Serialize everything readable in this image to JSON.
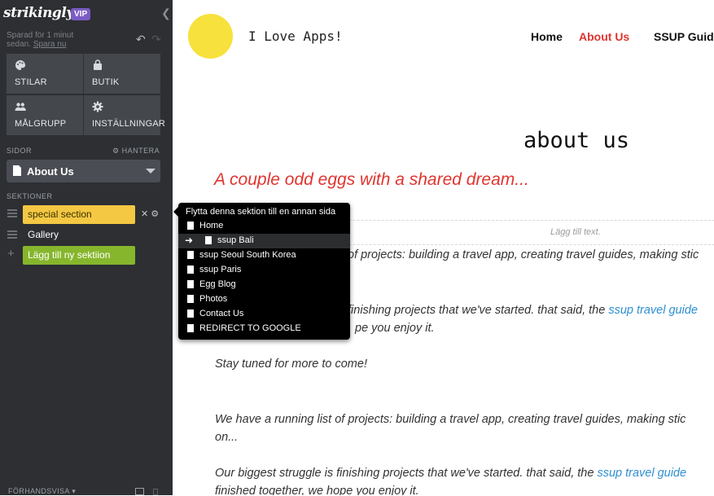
{
  "sidebar": {
    "logo": "strikingly",
    "vip_badge": "VIP",
    "saved_text": "Sparad för 1 minut sedan.",
    "save_now": "Spara nu",
    "tiles": [
      {
        "label": "STILAR",
        "icon": "palette-icon"
      },
      {
        "label": "BUTIK",
        "icon": "shopping-bag-icon"
      },
      {
        "label": "MÅLGRUPP",
        "icon": "people-icon"
      },
      {
        "label": "INSTÄLLNINGAR",
        "icon": "gear-icon"
      }
    ],
    "pages_label": "SIDOR",
    "manage_label": "HANTERA",
    "current_page": "About Us",
    "sections_label": "SEKTIONER",
    "sections": [
      "special section",
      "Gallery"
    ],
    "add_section": "Lägg till ny sektiion",
    "preview_label": "FÖRHANDSVISA"
  },
  "popup": {
    "title": "Flytta denna sektion till en annan sida",
    "items": [
      "Home",
      "ssup Bali",
      "ssup Seoul South Korea",
      "ssup Paris",
      "Egg Blog",
      "Photos",
      "Contact Us",
      "REDIRECT TO GOOGLE"
    ],
    "current_index": 1
  },
  "site": {
    "title": "I Love Apps!",
    "nav": [
      "Home",
      "About Us",
      "SSUP Guid"
    ],
    "heading": "about us",
    "subheading": "A couple odd eggs with a shared dream...",
    "add_text": "Lägg till text.",
    "p1_a": "of projects: building a travel app, creating travel guides, making stic",
    "p2_a": "finishing projects that we've started. that said, the ",
    "p2_link": "ssup travel guide",
    "p2_b": "pe you enjoy it.",
    "p3": "Stay tuned for more to come!",
    "p4_a": "We have a running list of projects: building a travel app, creating travel guides, making stic",
    "p4_b": "on...",
    "p5_a": "Our biggest struggle is finishing projects that we've started. that said, the ",
    "p5_link": "ssup travel guide",
    "p5_b": "finished together, we hope you enjoy it."
  }
}
